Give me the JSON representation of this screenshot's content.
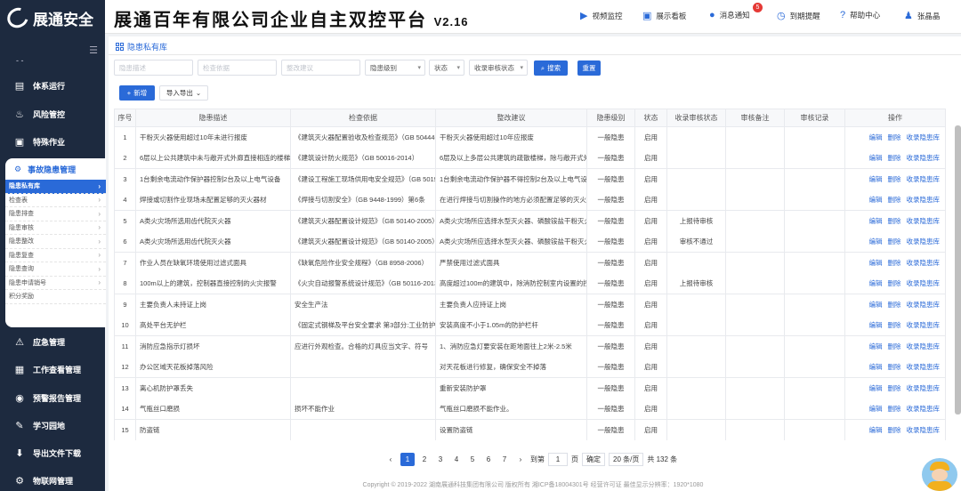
{
  "app": {
    "logo_text": "展通安全",
    "title": "展通百年有限公司企业自主双控平台",
    "version": "V2.16"
  },
  "topbar": {
    "items": [
      "视频监控",
      "展示看板",
      "消息通知",
      "到期提醒",
      "帮助中心",
      "张晶晶"
    ],
    "notify_count": "5"
  },
  "sidebar": {
    "dash": "- -",
    "items_top": [
      {
        "label": "体系运行",
        "icon": "server-icon"
      },
      {
        "label": "风险管控",
        "icon": "fire-icon"
      },
      {
        "label": "特殊作业",
        "icon": "doc-icon"
      }
    ],
    "group": {
      "label": "事故隐患管理",
      "items": [
        "隐患私有库",
        "检查表",
        "隐患排查",
        "隐患审核",
        "隐患整改",
        "隐患复查",
        "隐患查询",
        "隐患申请销号",
        "积分奖励"
      ],
      "active_index": 0
    },
    "items_bottom": [
      {
        "label": "应急管理",
        "icon": "emergency-icon"
      },
      {
        "label": "工作查看管理",
        "icon": "calendar-icon"
      },
      {
        "label": "预警报告管理",
        "icon": "alert-icon"
      },
      {
        "label": "学习园地",
        "icon": "learn-icon"
      },
      {
        "label": "导出文件下载",
        "icon": "download-icon"
      },
      {
        "label": "物联网管理",
        "icon": "iot-icon"
      }
    ]
  },
  "breadcrumb": "隐患私有库",
  "filters": {
    "desc_placeholder": "隐患描述",
    "basis_placeholder": "检查依据",
    "suggest_placeholder": "整改建议",
    "level": "隐患级别",
    "status": "状态",
    "audit": "收录审核状态",
    "search": "搜索",
    "reset": "重置"
  },
  "actions": {
    "add": "新增",
    "import_export": "导入导出"
  },
  "table": {
    "headers": [
      "序号",
      "隐患描述",
      "检查依据",
      "整改建议",
      "隐患级别",
      "状态",
      "收录审核状态",
      "审核备注",
      "审核记录",
      "操作"
    ],
    "ops": [
      "编辑",
      "删除",
      "收录隐患库"
    ],
    "rows": [
      [
        "1",
        "干粉灭火器使用超过10年未进行报废",
        "《建筑灭火器配置验收及检查规范》（GB 50444-2008）",
        "干粉灭火器使用超过10年应报废",
        "一般隐患",
        "启用",
        "",
        "",
        ""
      ],
      [
        "2",
        "6层以上公共建筑中未与敞开式外廊直接相连的楼梯间",
        "《建筑设计防火规范》（GB 50016-2014）",
        "6层及以上多层公共建筑的疏散楼梯，除与敞开式外廊直接相连的楼梯间外",
        "一般隐患",
        "启用",
        "",
        "",
        ""
      ],
      [
        "3",
        "1台剩余电流动作保护器控制2台及以上电气设备",
        "《建设工程施工现场供用电安全规范》（GB 50194-2014）",
        "1台剩余电流动作保护器不得控制2台及以上电气设备",
        "一般隐患",
        "启用",
        "",
        "",
        ""
      ],
      [
        "4",
        "焊接或切割作业现场未配置足够的灭火器材",
        "《焊接与切割安全》（GB 9448-1999）第6条",
        "在进行焊接与切割操作的地方必须配置足够的灭火设备",
        "一般隐患",
        "启用",
        "",
        "",
        ""
      ],
      [
        "5",
        "A类火灾场所选用齿代院灭火器",
        "《建筑灭火器配置设计规范》（GB 50140-2005）",
        "A类火灾场所应选择水型灭火器、磷酸铵盐干粉灭火器",
        "一般隐患",
        "启用",
        "上报待审核",
        "",
        ""
      ],
      [
        "6",
        "A类火灾场所选用齿代院灭火器",
        "《建筑灭火器配置设计规范》（GB 50140-2005）",
        "A类火灾场所应选择水型灭火器、磷酸铵盐干粉灭火器",
        "一般隐患",
        "启用",
        "审核不通过",
        "",
        ""
      ],
      [
        "7",
        "作业人员在缺氧环境使用过滤式面具",
        "《缺氧危险作业安全规程》（GB 8958-2006）",
        "严禁使用过滤式面具",
        "一般隐患",
        "启用",
        "",
        "",
        ""
      ],
      [
        "8",
        "100m以上的建筑，控制器直接控制的火灾报警",
        "《火灾自动报警系统设计规范》（GB 50116-2013）",
        "高度超过100m的建筑中，除消防控制室内设置的控制器外",
        "一般隐患",
        "启用",
        "上报待审核",
        "",
        ""
      ],
      [
        "9",
        "主要负责人未持证上岗",
        "安全生产法",
        "主要负责人应持证上岗",
        "一般隐患",
        "启用",
        "",
        "",
        ""
      ],
      [
        "10",
        "高处平台无护栏",
        "《固定式钢梯及平台安全要求 第3部分:工业防护栏杆及钢平台》",
        "安装高度不小于1.05m的防护栏杆",
        "一般隐患",
        "启用",
        "",
        "",
        ""
      ],
      [
        "11",
        "消防应急指示灯损坏",
        "应进行外观检查。合格的灯具应当文字、符号",
        "1、消防应急灯要安装在距地面往上2米-2.5米",
        "一般隐患",
        "启用",
        "",
        "",
        ""
      ],
      [
        "12",
        "办公区域天花板掉落风险",
        "",
        "对天花板进行修复，确保安全不掉落",
        "一般隐患",
        "启用",
        "",
        "",
        ""
      ],
      [
        "13",
        "离心机防护罩丢失",
        "",
        "重新安装防护罩",
        "一般隐患",
        "启用",
        "",
        "",
        ""
      ],
      [
        "14",
        "气瓶丝口磨损",
        "损坏不能作业",
        "气瓶丝口磨损不能作业。",
        "一般隐患",
        "启用",
        "",
        "",
        ""
      ],
      [
        "15",
        "防盗链",
        "",
        "设置防盗链",
        "一般隐患",
        "启用",
        "",
        "",
        ""
      ]
    ]
  },
  "pager": {
    "prev": "‹",
    "pages": [
      "1",
      "2",
      "3",
      "4",
      "5",
      "6",
      "7"
    ],
    "next": "›",
    "goto": "到第",
    "page_value": "1",
    "page_unit": "页",
    "confirm": "确定",
    "size": "20 条/页",
    "total": "共 132 条"
  },
  "footer": "Copyright © 2019-2022 湖南展通科技集团有限公司 版权所有 湘ICP备18004301号 经营许可证 最佳显示分辨率：1920*1080"
}
